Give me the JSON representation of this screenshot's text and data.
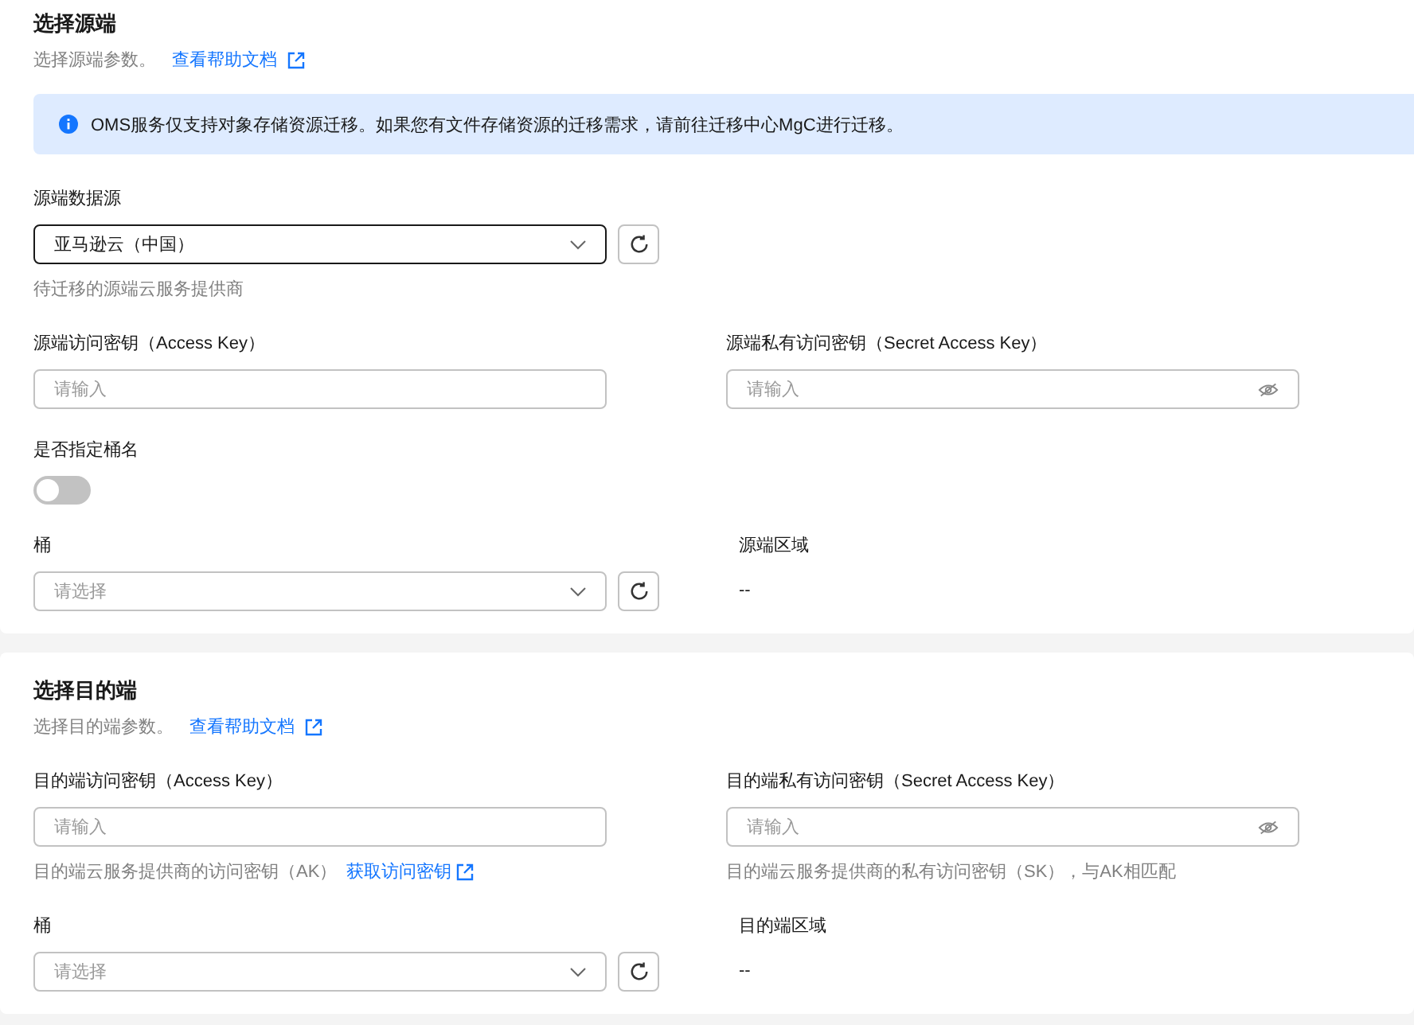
{
  "sections": [
    {
      "title": "选择源端",
      "intro": "选择源端参数。",
      "help_link": "查看帮助文档",
      "notice": "OMS服务仅支持对象存储资源迁移。如果您有文件存储资源的迁移需求，请前往迁移中心MgC进行迁移。",
      "rows": [
        [
          {
            "kind": "select",
            "label": "源端数据源",
            "value": "亚马逊云（中国）",
            "focused": true,
            "hint": "待迁移的源端云服务提供商"
          }
        ],
        [
          {
            "kind": "input",
            "label": "源端访问密钥（Access Key）",
            "placeholder": "请输入"
          },
          {
            "kind": "password",
            "label": "源端私有访问密钥（Secret Access Key）",
            "placeholder": "请输入"
          }
        ],
        [
          {
            "kind": "toggle",
            "label": "是否指定桶名",
            "on": false
          }
        ],
        [
          {
            "kind": "select",
            "label": "桶",
            "placeholder": "请选择",
            "focused": false
          },
          {
            "kind": "readonly",
            "label": "源端区域",
            "value": "--"
          }
        ]
      ]
    },
    {
      "title": "选择目的端",
      "intro": "选择目的端参数。",
      "help_link": "查看帮助文档",
      "rows": [
        [
          {
            "kind": "input",
            "label": "目的端访问密钥（Access Key）",
            "placeholder": "请输入",
            "hint": "目的端云服务提供商的访问密钥（AK）",
            "hint_link": "获取访问密钥"
          },
          {
            "kind": "password",
            "label": "目的端私有访问密钥（Secret Access Key）",
            "placeholder": "请输入",
            "hint": "目的端云服务提供商的私有访问密钥（SK），与AK相匹配"
          }
        ],
        [
          {
            "kind": "select",
            "label": "桶",
            "placeholder": "请选择",
            "focused": false
          },
          {
            "kind": "readonly",
            "label": "目的端区域",
            "value": "--"
          }
        ]
      ]
    }
  ]
}
